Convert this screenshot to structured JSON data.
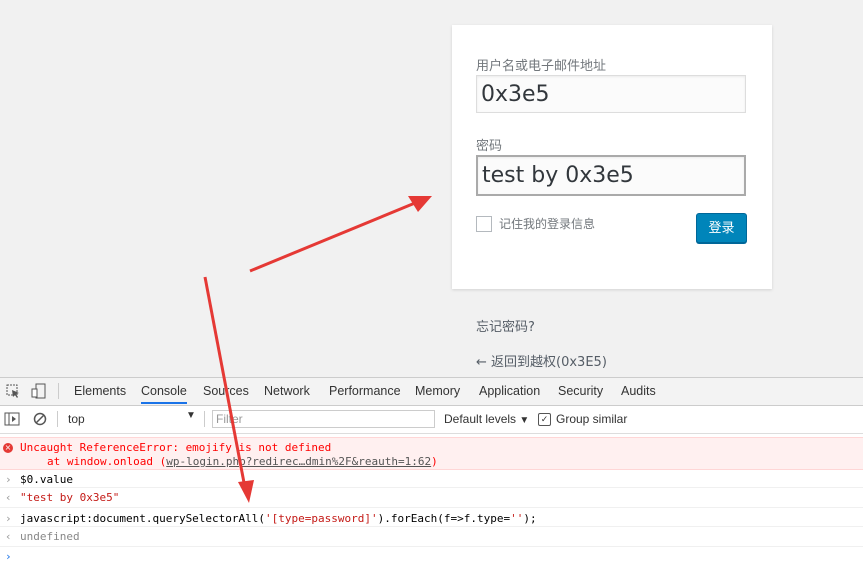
{
  "login": {
    "username_label": "用户名或电子邮件地址",
    "username_value": "0x3e5",
    "password_label": "密码",
    "password_value": "test by 0x3e5",
    "remember_label": "记住我的登录信息",
    "login_button": "登录",
    "forgot_link": "忘记密码?",
    "back_link": "← 返回到越权(0x3E5)"
  },
  "devtools": {
    "tabs": [
      "Elements",
      "Console",
      "Sources",
      "Network",
      "Performance",
      "Memory",
      "Application",
      "Security",
      "Audits"
    ],
    "selected_tab": "Console",
    "context": "top",
    "filter_placeholder": "Filter",
    "levels": "Default levels",
    "group_similar": "Group similar",
    "group_similar_checked": true
  },
  "console": {
    "error_line1": "Uncaught ReferenceError: emojify is not defined",
    "error_line2_prefix": "at window.onload (",
    "error_link": "wp-login.php?redirec…dmin%2F&reauth=1:62",
    "error_line2_suffix": ")",
    "cmd1": "$0.value",
    "result1": "\"test by 0x3e5\"",
    "cmd2_a": "javascript:document.querySelectorAll(",
    "cmd2_str": "'[type=password]'",
    "cmd2_b": ").forEach(f=>f.type=",
    "cmd2_str2": "''",
    "cmd2_c": ");",
    "result2": "undefined"
  },
  "colors": {
    "accent": "#0085ba",
    "arrow": "#e53935",
    "error": "#ff0000"
  }
}
